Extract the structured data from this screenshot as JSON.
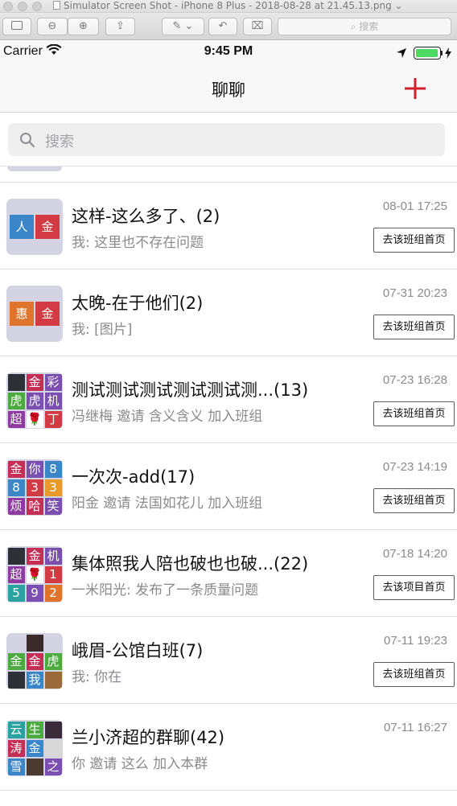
{
  "mac_window": {
    "title": "Simulator Screen Shot - iPhone 8 Plus - 2018-08-28 at 21.45.13.png",
    "search_placeholder": "搜索"
  },
  "status_bar": {
    "carrier": "Carrier",
    "time": "9:45 PM",
    "battery_level": 1.0
  },
  "nav": {
    "title": "聊聊",
    "add_icon": "plus-icon",
    "accent_color": "#d0212a"
  },
  "search": {
    "placeholder": "搜索"
  },
  "chats": [
    {
      "title": "这样-这么多了、(2)",
      "subtitle": "我: 这里也不存在问题",
      "time": "08-01 17:25",
      "button": "去该班组首页",
      "avatar": {
        "cols": 2,
        "rows": 1,
        "tiles": [
          {
            "text": "人",
            "color": "#3a86c8"
          },
          {
            "text": "金",
            "color": "#d23b44"
          }
        ]
      }
    },
    {
      "title": "太晚-在于他们(2)",
      "subtitle": "我: [图片]",
      "time": "07-31 20:23",
      "button": "去该班组首页",
      "avatar": {
        "cols": 2,
        "rows": 1,
        "tiles": [
          {
            "text": "惠",
            "color": "#e0742c"
          },
          {
            "text": "金",
            "color": "#d23b44"
          }
        ]
      }
    },
    {
      "title": "测试测试测试测试测试测...(13)",
      "subtitle": "冯继梅 邀请 含义含义 加入班组",
      "time": "07-23 16:28",
      "button": "去该班组首页",
      "avatar": {
        "cols": 3,
        "rows": 3,
        "tiles": [
          {
            "text": "",
            "color": "#2e3038",
            "photo": true
          },
          {
            "text": "金",
            "color": "#c52f56"
          },
          {
            "text": "彩",
            "color": "#7b4fb0"
          },
          {
            "text": "虎",
            "color": "#4bab3f"
          },
          {
            "text": "虎",
            "color": "#7b4fb0"
          },
          {
            "text": "机",
            "color": "#7b4fb0"
          },
          {
            "text": "超",
            "color": "#8e3aa0"
          },
          {
            "text": "🌹",
            "color": "#ffffff"
          },
          {
            "text": "丁",
            "color": "#d23b44"
          }
        ]
      }
    },
    {
      "title": "一次次-add(17)",
      "subtitle": "阳金 邀请 法国如花儿 加入班组",
      "time": "07-23 14:19",
      "button": "去该班组首页",
      "avatar": {
        "cols": 3,
        "rows": 3,
        "tiles": [
          {
            "text": "金",
            "color": "#c52f56"
          },
          {
            "text": "你",
            "color": "#7b4fb0"
          },
          {
            "text": "8",
            "color": "#3a86c8"
          },
          {
            "text": "8",
            "color": "#3a86c8"
          },
          {
            "text": "3",
            "color": "#d23b44"
          },
          {
            "text": "3",
            "color": "#e89a2c"
          },
          {
            "text": "烦",
            "color": "#8e3aa0"
          },
          {
            "text": "哈",
            "color": "#c52f56"
          },
          {
            "text": "笑",
            "color": "#7b4fb0"
          }
        ]
      }
    },
    {
      "title": "集体照我人陪也破也也破...(22)",
      "subtitle": "一米阳光: 发布了一条质量问题",
      "time": "07-18 14:20",
      "button": "去该项目首页",
      "avatar": {
        "cols": 3,
        "rows": 3,
        "tiles": [
          {
            "text": "",
            "color": "#2e3038",
            "photo": true
          },
          {
            "text": "金",
            "color": "#c52f56"
          },
          {
            "text": "机",
            "color": "#7b4fb0"
          },
          {
            "text": "超",
            "color": "#8e3aa0"
          },
          {
            "text": "🌹",
            "color": "#ffffff"
          },
          {
            "text": "1",
            "color": "#d23b44"
          },
          {
            "text": "5",
            "color": "#2aa2a0"
          },
          {
            "text": "9",
            "color": "#7b4fb0"
          },
          {
            "text": "2",
            "color": "#e0742c"
          }
        ]
      }
    },
    {
      "title": "峨眉-公馆白班(7)",
      "subtitle": "我: 你在",
      "time": "07-11 19:23",
      "button": "去该班组首页",
      "avatar": {
        "cols": 3,
        "rows": 3,
        "tiles": [
          {
            "text": "",
            "color": "#d3d3e3",
            "empty": true
          },
          {
            "text": "",
            "color": "#3b2a2a",
            "photo": true
          },
          {
            "text": "",
            "color": "#d3d3e3",
            "empty": true
          },
          {
            "text": "金",
            "color": "#4bab3f"
          },
          {
            "text": "金",
            "color": "#c52f56"
          },
          {
            "text": "虎",
            "color": "#4bab3f"
          },
          {
            "text": "",
            "color": "#2e3038",
            "photo": true
          },
          {
            "text": "我",
            "color": "#3a86c8"
          },
          {
            "text": "",
            "color": "#9a6a3a",
            "photo": true
          }
        ]
      }
    },
    {
      "title": "兰小济超的群聊(42)",
      "subtitle": "你 邀请 这么 加入本群",
      "time": "07-11 16:27",
      "button": "",
      "avatar": {
        "cols": 3,
        "rows": 3,
        "tiles": [
          {
            "text": "云",
            "color": "#2aa2a0"
          },
          {
            "text": "生",
            "color": "#4bab3f"
          },
          {
            "text": "",
            "color": "#3b2a3a",
            "photo": true
          },
          {
            "text": "涛",
            "color": "#c52f56"
          },
          {
            "text": "金",
            "color": "#3a86c8"
          },
          {
            "text": "",
            "color": "#d8d8d8",
            "photo": true
          },
          {
            "text": "雪",
            "color": "#3a86c8"
          },
          {
            "text": "",
            "color": "#4a3a30",
            "photo": true
          },
          {
            "text": "之",
            "color": "#7b4fb0"
          }
        ]
      }
    }
  ]
}
